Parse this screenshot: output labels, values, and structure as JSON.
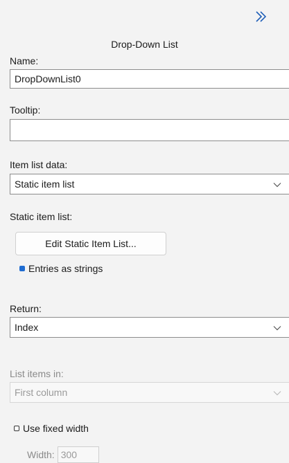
{
  "panel": {
    "title": "Drop-Down List",
    "collapse_icon": "double-chevron-right-icon",
    "accent_color": "#1f6cd1"
  },
  "name": {
    "label": "Name:",
    "value": "DropDownList0"
  },
  "tooltip": {
    "label": "Tooltip:",
    "value": ""
  },
  "item_list_data": {
    "label": "Item list data:",
    "selected": "Static item list"
  },
  "static_item_list": {
    "label": "Static item list:",
    "button_label": "Edit Static Item List...",
    "entries_checkbox_label": "Entries as strings",
    "entries_checked": true
  },
  "return": {
    "label": "Return:",
    "selected": "Index"
  },
  "list_items_in": {
    "label": "List items in:",
    "selected": "First column",
    "disabled": true
  },
  "fixed_width": {
    "checkbox_label": "Use fixed width",
    "checked": false,
    "width_label": "Width:",
    "width_value": "300"
  }
}
